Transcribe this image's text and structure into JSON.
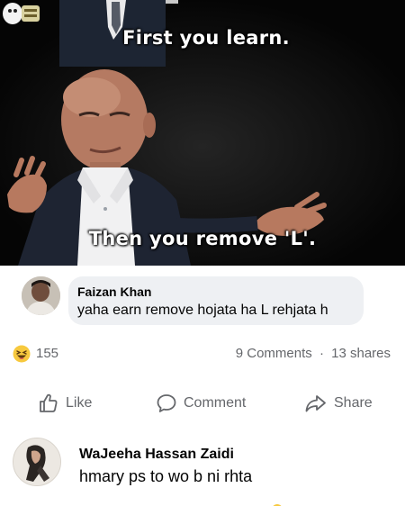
{
  "meme": {
    "caption_top": "First you learn.",
    "caption_bottom": "Then you remove 'L'."
  },
  "embedded_comment": {
    "author": "Faizan Khan",
    "text": "yaha earn remove hojata ha L rehjata h"
  },
  "reactions": {
    "icon": "haha-emoji-icon",
    "count": "155",
    "comments": "9 Comments",
    "separator": "·",
    "shares": "13 shares"
  },
  "actions": {
    "like": "Like",
    "comment": "Comment",
    "share": "Share"
  },
  "comment": {
    "author": "WaJeeha Hassan Zaidi",
    "text": "hmary ps to wo b ni rhta"
  },
  "colors": {
    "muted_text": "#65676b",
    "bubble_bg": "#eef0f3",
    "meme_bg": "#070707",
    "haha_yellow": "#f7c93e"
  }
}
